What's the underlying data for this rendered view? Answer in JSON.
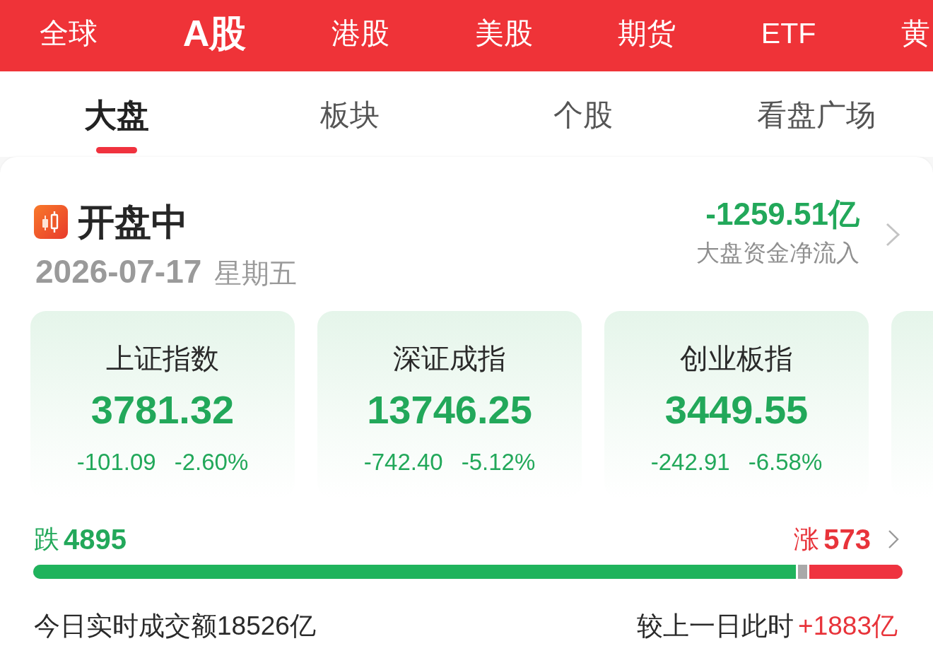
{
  "market_tabs": [
    {
      "label": "全球",
      "selected": false
    },
    {
      "label": "A股",
      "selected": true
    },
    {
      "label": "港股",
      "selected": false
    },
    {
      "label": "美股",
      "selected": false
    },
    {
      "label": "期货",
      "selected": false
    },
    {
      "label": "ETF",
      "selected": false
    },
    {
      "label": "黄",
      "selected": false
    }
  ],
  "view_tabs": [
    {
      "label": "大盘",
      "selected": true
    },
    {
      "label": "板块",
      "selected": false
    },
    {
      "label": "个股",
      "selected": false
    },
    {
      "label": "看盘广场",
      "selected": false
    }
  ],
  "status": {
    "title": "开盘中",
    "date": "2026-07-17",
    "weekday": "星期五"
  },
  "fund_flow": {
    "value": "-1259.51亿",
    "label": "大盘资金净流入"
  },
  "indices": [
    {
      "name": "上证指数",
      "value": "3781.32",
      "change": "-101.09",
      "change_pct": "-2.60%"
    },
    {
      "name": "深证成指",
      "value": "13746.25",
      "change": "-742.40",
      "change_pct": "-5.12%"
    },
    {
      "name": "创业板指",
      "value": "3449.55",
      "change": "-242.91",
      "change_pct": "-6.58%"
    }
  ],
  "breadth": {
    "falling": {
      "label": "跌",
      "count": "4895",
      "level": 0.88
    },
    "rising": {
      "label": "涨",
      "count": "573",
      "level": 0.11
    }
  },
  "turnover": {
    "label": "今日实时成交额18526亿",
    "compare_label": "较上一日此时",
    "compare_value": "+1883亿"
  }
}
